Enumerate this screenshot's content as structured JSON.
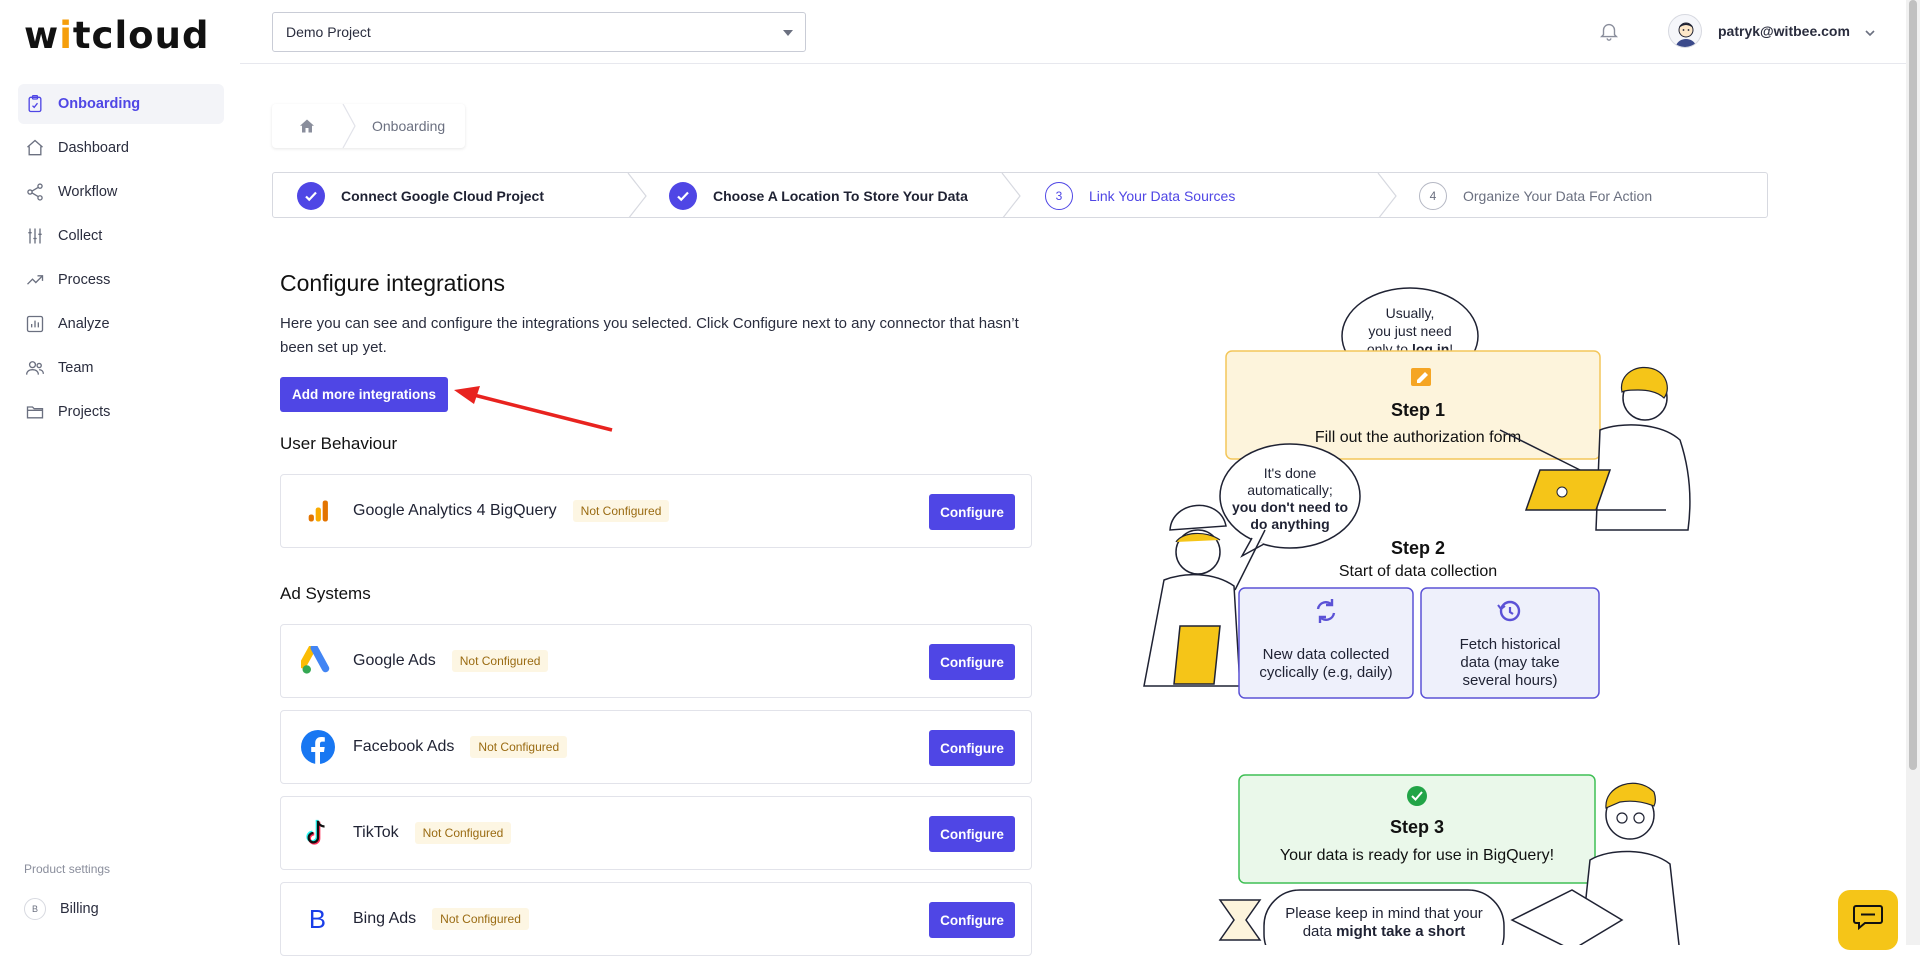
{
  "app": {
    "logo_text": "witcloud",
    "accent": "#4f46e5"
  },
  "sidebar": {
    "items": [
      {
        "label": "Onboarding",
        "icon": "clipboard-icon",
        "active": true
      },
      {
        "label": "Dashboard",
        "icon": "home-icon"
      },
      {
        "label": "Workflow",
        "icon": "share-icon"
      },
      {
        "label": "Collect",
        "icon": "sliders-icon"
      },
      {
        "label": "Process",
        "icon": "trend-icon"
      },
      {
        "label": "Analyze",
        "icon": "bar-chart-icon"
      },
      {
        "label": "Team",
        "icon": "users-icon"
      },
      {
        "label": "Projects",
        "icon": "folder-icon"
      }
    ],
    "settings_title": "Product settings",
    "billing": {
      "initial": "B",
      "label": "Billing"
    }
  },
  "header": {
    "project": "Demo Project",
    "user_email": "patryk@witbee.com"
  },
  "breadcrumb": {
    "current": "Onboarding"
  },
  "stepper": {
    "steps": [
      {
        "label": "Connect Google Cloud Project",
        "state": "done"
      },
      {
        "label": "Choose A Location To Store Your Data",
        "state": "done"
      },
      {
        "num": "3",
        "label": "Link Your Data Sources",
        "state": "current"
      },
      {
        "num": "4",
        "label": "Organize Your Data For Action",
        "state": "todo"
      }
    ]
  },
  "main": {
    "title": "Configure integrations",
    "description": "Here you can see and configure the integrations you selected. Click Configure next to any connector that hasn’t been set up yet.",
    "add_button": "Add more integrations",
    "configure_label": "Configure",
    "sections": [
      {
        "title": "User Behaviour",
        "integrations": [
          {
            "name": "Google Analytics 4 BigQuery",
            "status": "Not Configured",
            "icon": "google-analytics-icon"
          }
        ]
      },
      {
        "title": "Ad Systems",
        "integrations": [
          {
            "name": "Google Ads",
            "status": "Not Configured",
            "icon": "google-ads-icon"
          },
          {
            "name": "Facebook Ads",
            "status": "Not Configured",
            "icon": "facebook-icon"
          },
          {
            "name": "TikTok",
            "status": "Not Configured",
            "icon": "tiktok-icon"
          },
          {
            "name": "Bing Ads",
            "status": "Not Configured",
            "icon": "bing-icon"
          }
        ]
      }
    ]
  },
  "illustration": {
    "bubble1": {
      "line1": "Usually,",
      "line2": "you just need",
      "line3_pre": "only to ",
      "line3_bold": "log in",
      "line3_post": "!"
    },
    "step1": {
      "title": "Step 1",
      "text": "Fill out the authorization form"
    },
    "bubble2": {
      "line1": "It's done",
      "line2": "automatically;",
      "line3": "you don't need to",
      "line4": "do anything"
    },
    "step2": {
      "title": "Step 2",
      "text": "Start of data collection",
      "box1": [
        "New data collected",
        "cyclically (e.g, daily)"
      ],
      "box2": [
        "Fetch historical",
        "data (may take",
        "several hours)"
      ]
    },
    "step3": {
      "title": "Step 3",
      "text": "Your data is ready for use in BigQuery!"
    },
    "bubble3": {
      "line1": "Please keep in mind that your",
      "line2_pre": "data ",
      "line2_bold": "might take a short"
    }
  }
}
